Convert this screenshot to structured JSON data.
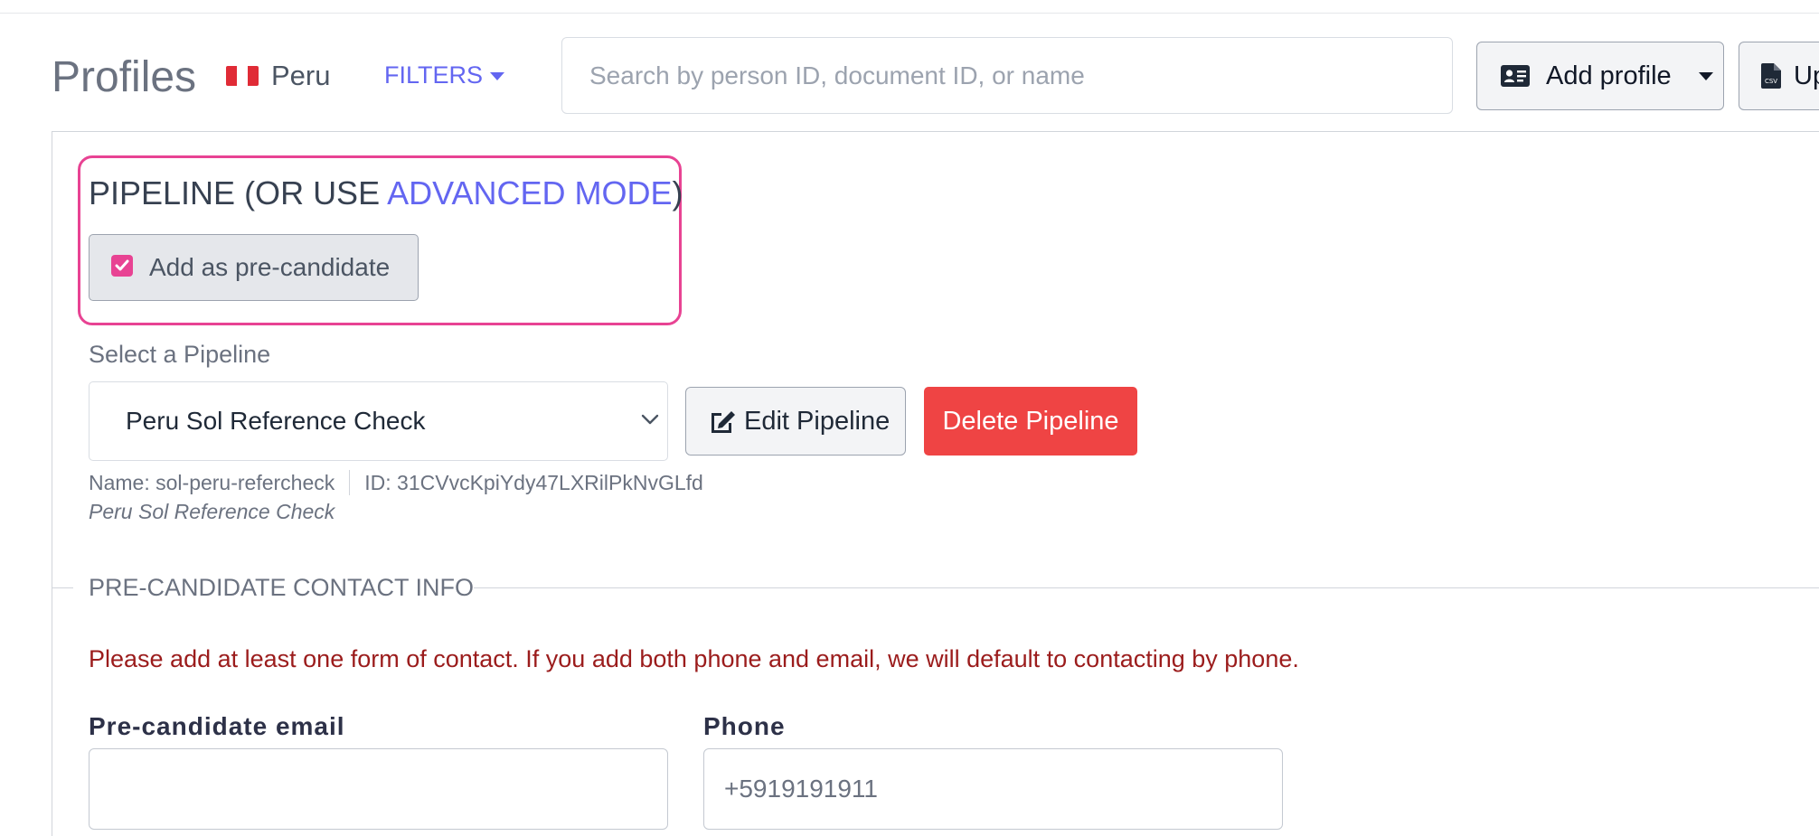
{
  "header": {
    "title": "Profiles",
    "country": "Peru",
    "filters_label": "FILTERS",
    "search_placeholder": "Search by person ID, document ID, or name",
    "add_profile_label": "Add profile",
    "upload_label": "Up"
  },
  "pipeline": {
    "heading_prefix": "PIPELINE (OR USE ",
    "heading_link": "ADVANCED MODE",
    "heading_suffix": ")",
    "precandidate_label": "Add as pre-candidate",
    "precandidate_checked": true,
    "select_label": "Select a Pipeline",
    "selected_pipeline": "Peru Sol Reference Check",
    "edit_label": "Edit Pipeline",
    "delete_label": "Delete Pipeline",
    "meta_name": "Name: sol-peru-refercheck",
    "meta_id": "ID: 31CVvcKpiYdy47LXRilPkNvGLfd",
    "description": "Peru Sol Reference Check"
  },
  "contact": {
    "section_title": "PRE-CANDIDATE CONTACT INFO",
    "warning": "Please add at least one form of contact. If you add both phone and email, we will default to contacting by phone.",
    "email_label": "Pre-candidate email",
    "email_value": "",
    "phone_label": "Phone",
    "phone_placeholder": "+5919191911"
  },
  "colors": {
    "accent": "#6366f1",
    "highlight": "#e84393",
    "danger": "#ef4444",
    "warning_text": "#9b1c1c"
  },
  "icons": {
    "flag": "peru-flag-icon",
    "filters": "caret-down-icon",
    "add_profile": "id-card-icon",
    "upload": "csv-file-icon",
    "edit": "edit-icon",
    "select": "chevron-down-icon",
    "checkbox": "checkmark-icon"
  }
}
